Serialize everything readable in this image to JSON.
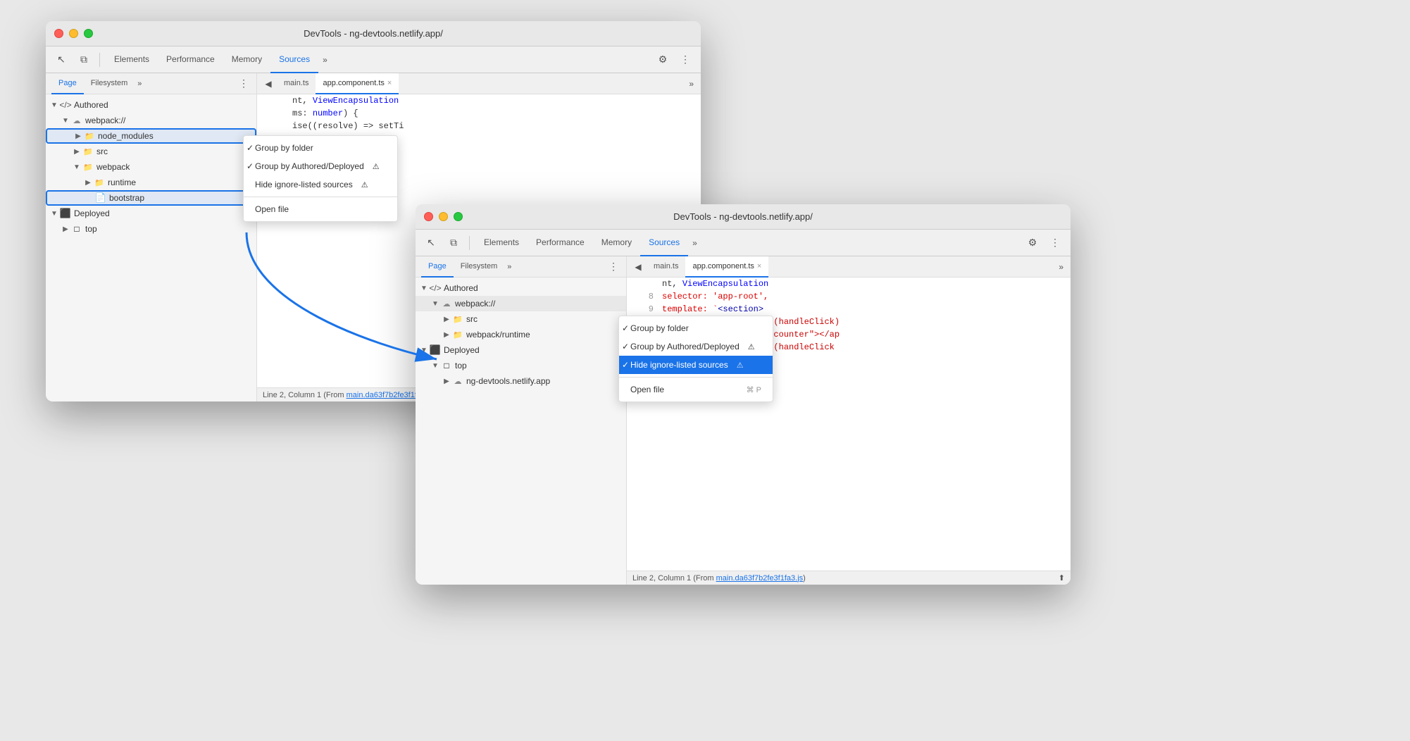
{
  "window1": {
    "title": "DevTools - ng-devtools.netlify.app/",
    "tabs": [
      "Elements",
      "Performance",
      "Memory",
      "Sources"
    ],
    "active_tab": "Sources",
    "panel_tabs": [
      "Page",
      "Filesystem"
    ],
    "active_panel_tab": "Page",
    "code_tabs": [
      "main.ts",
      "app.component.ts"
    ],
    "active_code_tab": "app.component.ts",
    "file_tree": [
      {
        "level": 1,
        "type": "authored-root",
        "label": "Authored",
        "arrow": "open"
      },
      {
        "level": 2,
        "type": "cloud",
        "label": "webpack://",
        "arrow": "open"
      },
      {
        "level": 3,
        "type": "folder",
        "label": "node_modules",
        "arrow": "closed",
        "highlighted": true
      },
      {
        "level": 3,
        "type": "folder",
        "label": "src",
        "arrow": "closed"
      },
      {
        "level": 3,
        "type": "folder",
        "label": "webpack",
        "arrow": "open"
      },
      {
        "level": 4,
        "type": "folder",
        "label": "runtime",
        "arrow": "closed"
      },
      {
        "level": 4,
        "type": "file-light",
        "label": "bootstrap",
        "highlighted": true
      },
      {
        "level": 1,
        "type": "deployed-root",
        "label": "Deployed",
        "arrow": "open"
      },
      {
        "level": 2,
        "type": "box",
        "label": "top",
        "arrow": "closed"
      }
    ],
    "code_lines": [
      {
        "num": "",
        "code": "nt, ViewEncapsulation"
      },
      {
        "num": "",
        "code": ""
      },
      {
        "num": "",
        "code": "ms: number) {"
      },
      {
        "num": "",
        "code": "ise((resolve) => setTi"
      }
    ],
    "status_bar": "Line 2, Column 1 (From main.da63f7b2fe3f1fa3.js)"
  },
  "window2": {
    "title": "DevTools - ng-devtools.netlify.app/",
    "tabs": [
      "Elements",
      "Performance",
      "Memory",
      "Sources"
    ],
    "active_tab": "Sources",
    "panel_tabs": [
      "Page",
      "Filesystem"
    ],
    "active_panel_tab": "Page",
    "code_tabs": [
      "main.ts",
      "app.component.ts"
    ],
    "active_code_tab": "app.component.ts",
    "file_tree": [
      {
        "level": 1,
        "type": "authored-root",
        "label": "Authored",
        "arrow": "open"
      },
      {
        "level": 2,
        "type": "cloud",
        "label": "webpack://",
        "arrow": "open"
      },
      {
        "level": 3,
        "type": "folder",
        "label": "src",
        "arrow": "closed"
      },
      {
        "level": 3,
        "type": "folder",
        "label": "webpack/runtime",
        "arrow": "closed"
      },
      {
        "level": 1,
        "type": "deployed-root",
        "label": "Deployed",
        "arrow": "open"
      },
      {
        "level": 2,
        "type": "box",
        "label": "top",
        "arrow": "open"
      },
      {
        "level": 3,
        "type": "cloud",
        "label": "ng-devtools.netlify.app",
        "arrow": "closed"
      }
    ],
    "code_lines": [
      {
        "num": "",
        "code": "nt, ViewEncapsulation"
      },
      {
        "num": "8",
        "code": "selector: 'app-root',"
      },
      {
        "num": "9",
        "code": "template: `<section>"
      },
      {
        "num": "10",
        "code": "<app-button label=\"-\" (handleClick)"
      },
      {
        "num": "11",
        "code": "<app-label [counter]=\"counter\"></ap"
      },
      {
        "num": "12",
        "code": "<app-button label=\"+\" (handleClick"
      }
    ],
    "status_bar": "Line 2, Column 1 (From ",
    "status_link": "main.da63f7b2fe3f1fa3.js",
    "status_bar_end": ")"
  },
  "menu1": {
    "items": [
      {
        "label": "Group by folder",
        "checked": true,
        "shortcut": ""
      },
      {
        "label": "Group by Authored/Deployed",
        "checked": true,
        "shortcut": "",
        "has_warning": true
      },
      {
        "label": "Hide ignore-listed sources",
        "checked": false,
        "shortcut": "",
        "has_warning": true
      },
      {
        "separator": true
      },
      {
        "label": "Open file",
        "checked": false,
        "shortcut": ""
      }
    ]
  },
  "menu2": {
    "items": [
      {
        "label": "Group by folder",
        "checked": true,
        "shortcut": ""
      },
      {
        "label": "Group by Authored/Deployed",
        "checked": true,
        "shortcut": "",
        "has_warning": true
      },
      {
        "label": "Hide ignore-listed sources",
        "checked": false,
        "shortcut": "",
        "has_warning": true,
        "active": true
      },
      {
        "separator": true
      },
      {
        "label": "Open file",
        "checked": false,
        "shortcut": "⌘ P"
      }
    ]
  },
  "icons": {
    "cursor": "↖",
    "layers": "⧉",
    "gear": "⚙",
    "more": "⋮",
    "more_horiz": "»",
    "back": "◀",
    "close": "×",
    "prev": "◀",
    "next": "▶"
  }
}
